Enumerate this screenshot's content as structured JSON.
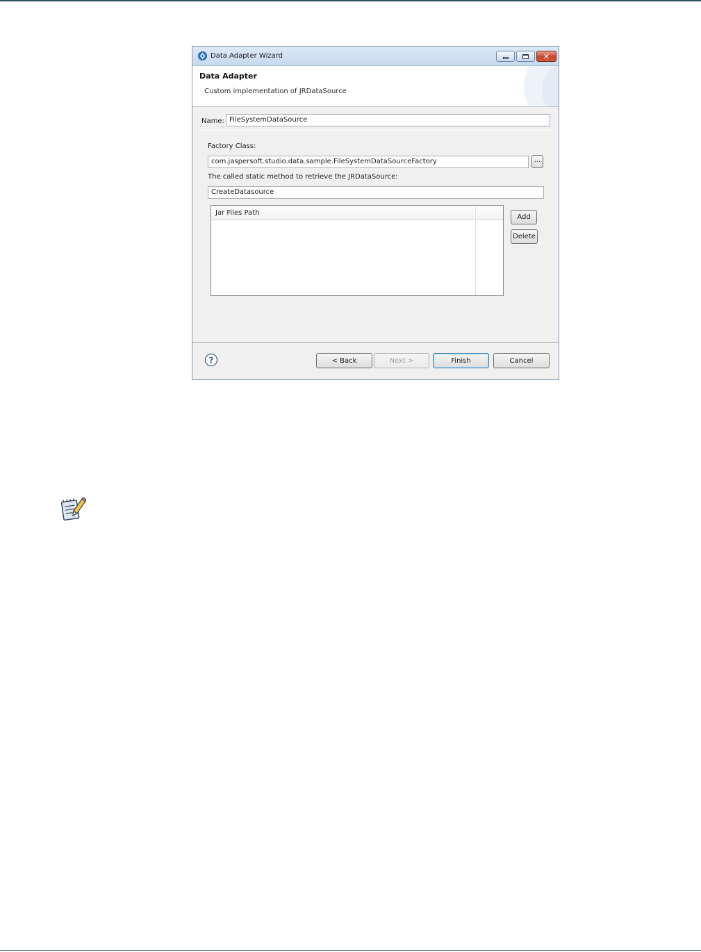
{
  "dialog": {
    "title": "Data Adapter Wizard",
    "header": {
      "title": "Data Adapter",
      "description": "Custom implementation of JRDataSource"
    },
    "name_label": "Name:",
    "name_value": "FileSystemDataSource",
    "factory_class_label": "Factory Class:",
    "factory_class_value": "com.jaspersoft.studio.data.sample.FileSystemDataSourceFactory",
    "browse_label": "...",
    "static_method_label": "The called static method to retrieve the JRDataSource:",
    "static_method_value": "CreateDatasource",
    "jar_table": {
      "columns": [
        "Jar Files Path"
      ],
      "rows": []
    },
    "add_label": "Add",
    "delete_label": "Delete",
    "footer": {
      "back_label": "< Back",
      "next_label": "Next >",
      "finish_label": "Finish",
      "cancel_label": "Cancel"
    }
  },
  "colors": {
    "page_rule": "#2d4f63",
    "titlebar": "#c7d9ee",
    "close_button": "#c6452c"
  },
  "icons": {
    "app": "data-adapter-icon",
    "help": "help-icon",
    "note": "note-pencil-icon"
  }
}
